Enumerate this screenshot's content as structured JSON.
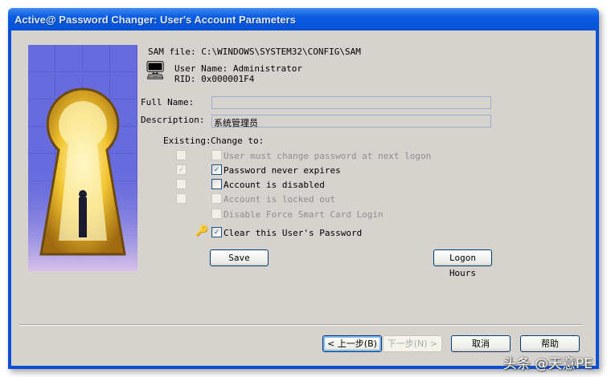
{
  "window": {
    "title": "Active@ Password Changer: User's Account Parameters"
  },
  "info": {
    "sam_file": "SAM file: C:\\WINDOWS\\SYSTEM32\\CONFIG\\SAM",
    "user_name": "User Name: Administrator",
    "rid": "RID: 0x000001F4"
  },
  "form": {
    "full_name_label": "Full Name:",
    "full_name_value": "",
    "description_label": "Description:",
    "description_value": "系统管理员"
  },
  "options": {
    "header_existing": "Existing:",
    "header_change": "Change to:",
    "items": [
      {
        "label": "User must change password at next logon",
        "existing": false,
        "change": false,
        "enabled": false
      },
      {
        "label": "Password never expires",
        "existing": true,
        "change": true,
        "enabled": true
      },
      {
        "label": "Account is disabled",
        "existing": false,
        "change": false,
        "enabled": true
      },
      {
        "label": "Account is locked out",
        "existing": false,
        "change": false,
        "enabled": false
      },
      {
        "label": "Disable Force Smart Card Login",
        "change": false,
        "enabled": false
      }
    ],
    "clear_password": {
      "label": "Clear this User's Password",
      "checked": true
    }
  },
  "buttons": {
    "save": "Save",
    "logon_hours": "Logon Hours",
    "back": "< 上一步(B)",
    "next": "下一步(N) >",
    "cancel": "取消",
    "help": "帮助"
  },
  "watermark": "头条 @天意PE",
  "colors": {
    "title_bar": "#0a5be0",
    "client": "#d6d3ce"
  }
}
